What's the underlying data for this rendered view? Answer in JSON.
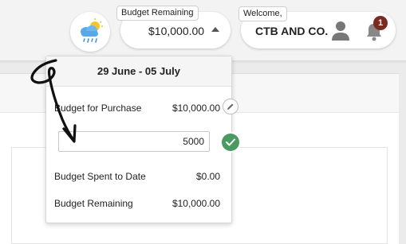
{
  "header": {
    "budget_tag": "Budget Remaining",
    "budget_amount": "$10,000.00",
    "welcome_tag": "Welcome,",
    "company_name": "CTB AND CO.",
    "notification_count": "1",
    "icons": [
      "weather-icon",
      "caret-up-icon",
      "user-icon",
      "bell-icon"
    ]
  },
  "budget_panel": {
    "date_range": "29 June - 05 July",
    "purchase_label": "Budget for Purchase",
    "purchase_value": "$10,000.00",
    "input_value": "5000",
    "spent_label": "Budget Spent to Date",
    "spent_value": "$0.00",
    "remaining_label": "Budget Remaining",
    "remaining_value": "$10,000.00",
    "icons": [
      "pencil-icon",
      "check-icon"
    ]
  },
  "colors": {
    "confirm_green": "#4c9a62",
    "badge": "#7a2a1e",
    "accent_pink": "#e05fa0"
  }
}
